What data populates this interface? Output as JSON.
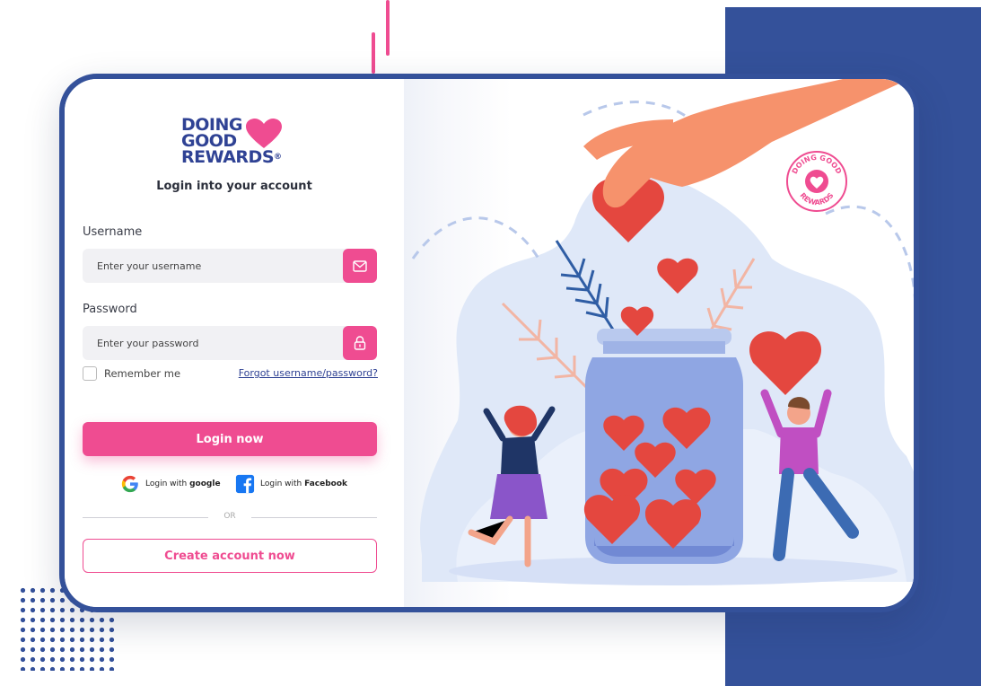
{
  "brand": {
    "logo_line1": "DOING",
    "logo_line2": "GOOD",
    "logo_line3": "REWARDS",
    "reg_mark": "®",
    "badge_top": "DOING GOOD",
    "badge_bottom": "REWARDS"
  },
  "form": {
    "subtitle": "Login into your account",
    "username_label": "Username",
    "username_placeholder": "Enter your username",
    "password_label": "Password",
    "password_placeholder": "Enter your password",
    "remember_label": "Remember me",
    "forgot_link": "Forgot username/password?",
    "login_button": "Login now",
    "google_prefix": "Login with ",
    "google_name": "google",
    "facebook_prefix": "Login with ",
    "facebook_name": "Facebook",
    "or_text": "OR",
    "create_button": "Create account now"
  },
  "icons": {
    "username_icon": "envelope-icon",
    "password_icon": "lock-icon",
    "google_icon": "google-icon",
    "facebook_icon": "facebook-icon"
  },
  "colors": {
    "brand_blue": "#34519a",
    "brand_pink": "#ef4c91",
    "heart_red": "#e4473f"
  }
}
